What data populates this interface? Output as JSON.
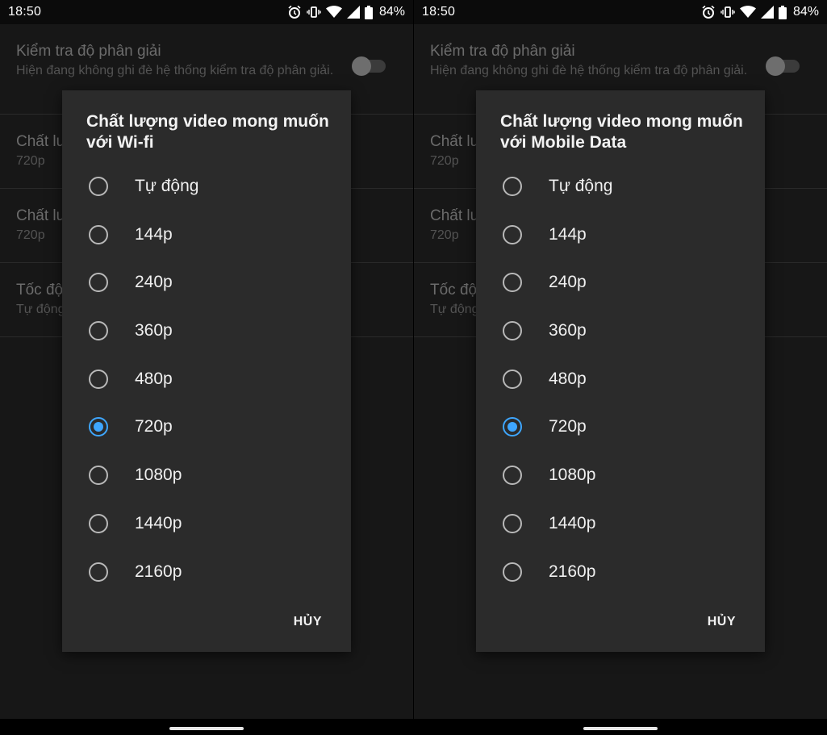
{
  "screens": [
    {
      "status": {
        "time": "18:50",
        "battery": "84%"
      },
      "settings": [
        {
          "title": "Kiểm tra độ phân giải",
          "subtitle": "Hiện đang không ghi đè hệ thống kiểm tra độ phân giải."
        },
        {
          "title": "Chất lư",
          "subtitle": "720p"
        },
        {
          "title": "Chất lư",
          "subtitle": "720p"
        },
        {
          "title": "Tốc độ",
          "subtitle": "Tự động"
        }
      ],
      "dialog": {
        "title": "Chất lượng video mong muốn với Wi-fi",
        "options": [
          {
            "label": "Tự động",
            "selected": false
          },
          {
            "label": "144p",
            "selected": false
          },
          {
            "label": "240p",
            "selected": false
          },
          {
            "label": "360p",
            "selected": false
          },
          {
            "label": "480p",
            "selected": false
          },
          {
            "label": "720p",
            "selected": true
          },
          {
            "label": "1080p",
            "selected": false
          },
          {
            "label": "1440p",
            "selected": false
          },
          {
            "label": "2160p",
            "selected": false
          }
        ],
        "cancel_label": "HỦY"
      }
    },
    {
      "status": {
        "time": "18:50",
        "battery": "84%"
      },
      "settings": [
        {
          "title": "Kiểm tra độ phân giải",
          "subtitle": "Hiện đang không ghi đè hệ thống kiểm tra độ phân giải."
        },
        {
          "title": "Chất lư",
          "subtitle": "720p"
        },
        {
          "title": "Chất lư",
          "subtitle": "720p"
        },
        {
          "title": "Tốc độ",
          "subtitle": "Tự động"
        }
      ],
      "dialog": {
        "title": "Chất lượng video mong muốn với Mobile Data",
        "options": [
          {
            "label": "Tự động",
            "selected": false
          },
          {
            "label": "144p",
            "selected": false
          },
          {
            "label": "240p",
            "selected": false
          },
          {
            "label": "360p",
            "selected": false
          },
          {
            "label": "480p",
            "selected": false
          },
          {
            "label": "720p",
            "selected": true
          },
          {
            "label": "1080p",
            "selected": false
          },
          {
            "label": "1440p",
            "selected": false
          },
          {
            "label": "2160p",
            "selected": false
          }
        ],
        "cancel_label": "HỦY"
      }
    }
  ],
  "colors": {
    "accent": "#3ea6ff",
    "dialog_bg": "#2b2b2b",
    "screen_bg": "#171717"
  },
  "icons": [
    "alarm-icon",
    "vibrate-icon",
    "wifi-icon",
    "cell-signal-icon",
    "battery-icon"
  ]
}
